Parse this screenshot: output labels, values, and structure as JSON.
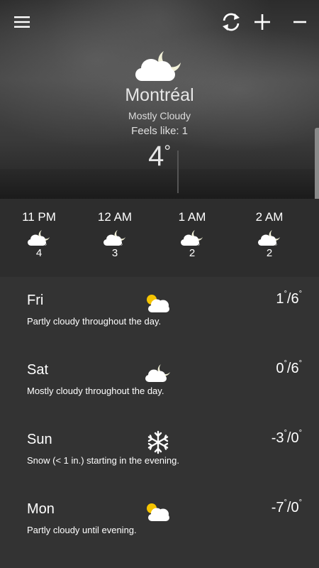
{
  "toolbar": {
    "menu_icon": "hamburger-menu-icon",
    "refresh_icon": "refresh-icon",
    "add_icon": "plus-icon",
    "remove_icon": "minus-icon"
  },
  "current": {
    "icon": "moon-cloud-icon",
    "city": "Montréal",
    "condition": "Mostly Cloudy",
    "feels_like_label": "Feels like:",
    "feels_like_value": "1",
    "temperature": "4",
    "degree_symbol": "°"
  },
  "hourly": [
    {
      "time": "11 PM",
      "icon": "moon-cloud-icon",
      "temp": "4"
    },
    {
      "time": "12 AM",
      "icon": "moon-cloud-icon",
      "temp": "3"
    },
    {
      "time": "1 AM",
      "icon": "moon-cloud-icon",
      "temp": "2"
    },
    {
      "time": "2 AM",
      "icon": "moon-cloud-icon",
      "temp": "2"
    }
  ],
  "daily": [
    {
      "day": "Fri",
      "icon": "sun-cloud-icon",
      "low": "1",
      "high": "6",
      "description": "Partly cloudy throughout the day."
    },
    {
      "day": "Sat",
      "icon": "moon-cloud-icon",
      "low": "0",
      "high": "6",
      "description": "Mostly cloudy throughout the day."
    },
    {
      "day": "Sun",
      "icon": "snowflake-icon",
      "low": "-3",
      "high": "0",
      "description": "Snow (< 1 in.) starting in the evening."
    },
    {
      "day": "Mon",
      "icon": "sun-cloud-icon",
      "low": "-7",
      "high": "0",
      "description": "Partly cloudy until evening."
    }
  ],
  "colors": {
    "background": "#333333",
    "hourly_background": "#2d2d2d",
    "sun": "#f5c400",
    "cloud": "#ffffff"
  }
}
